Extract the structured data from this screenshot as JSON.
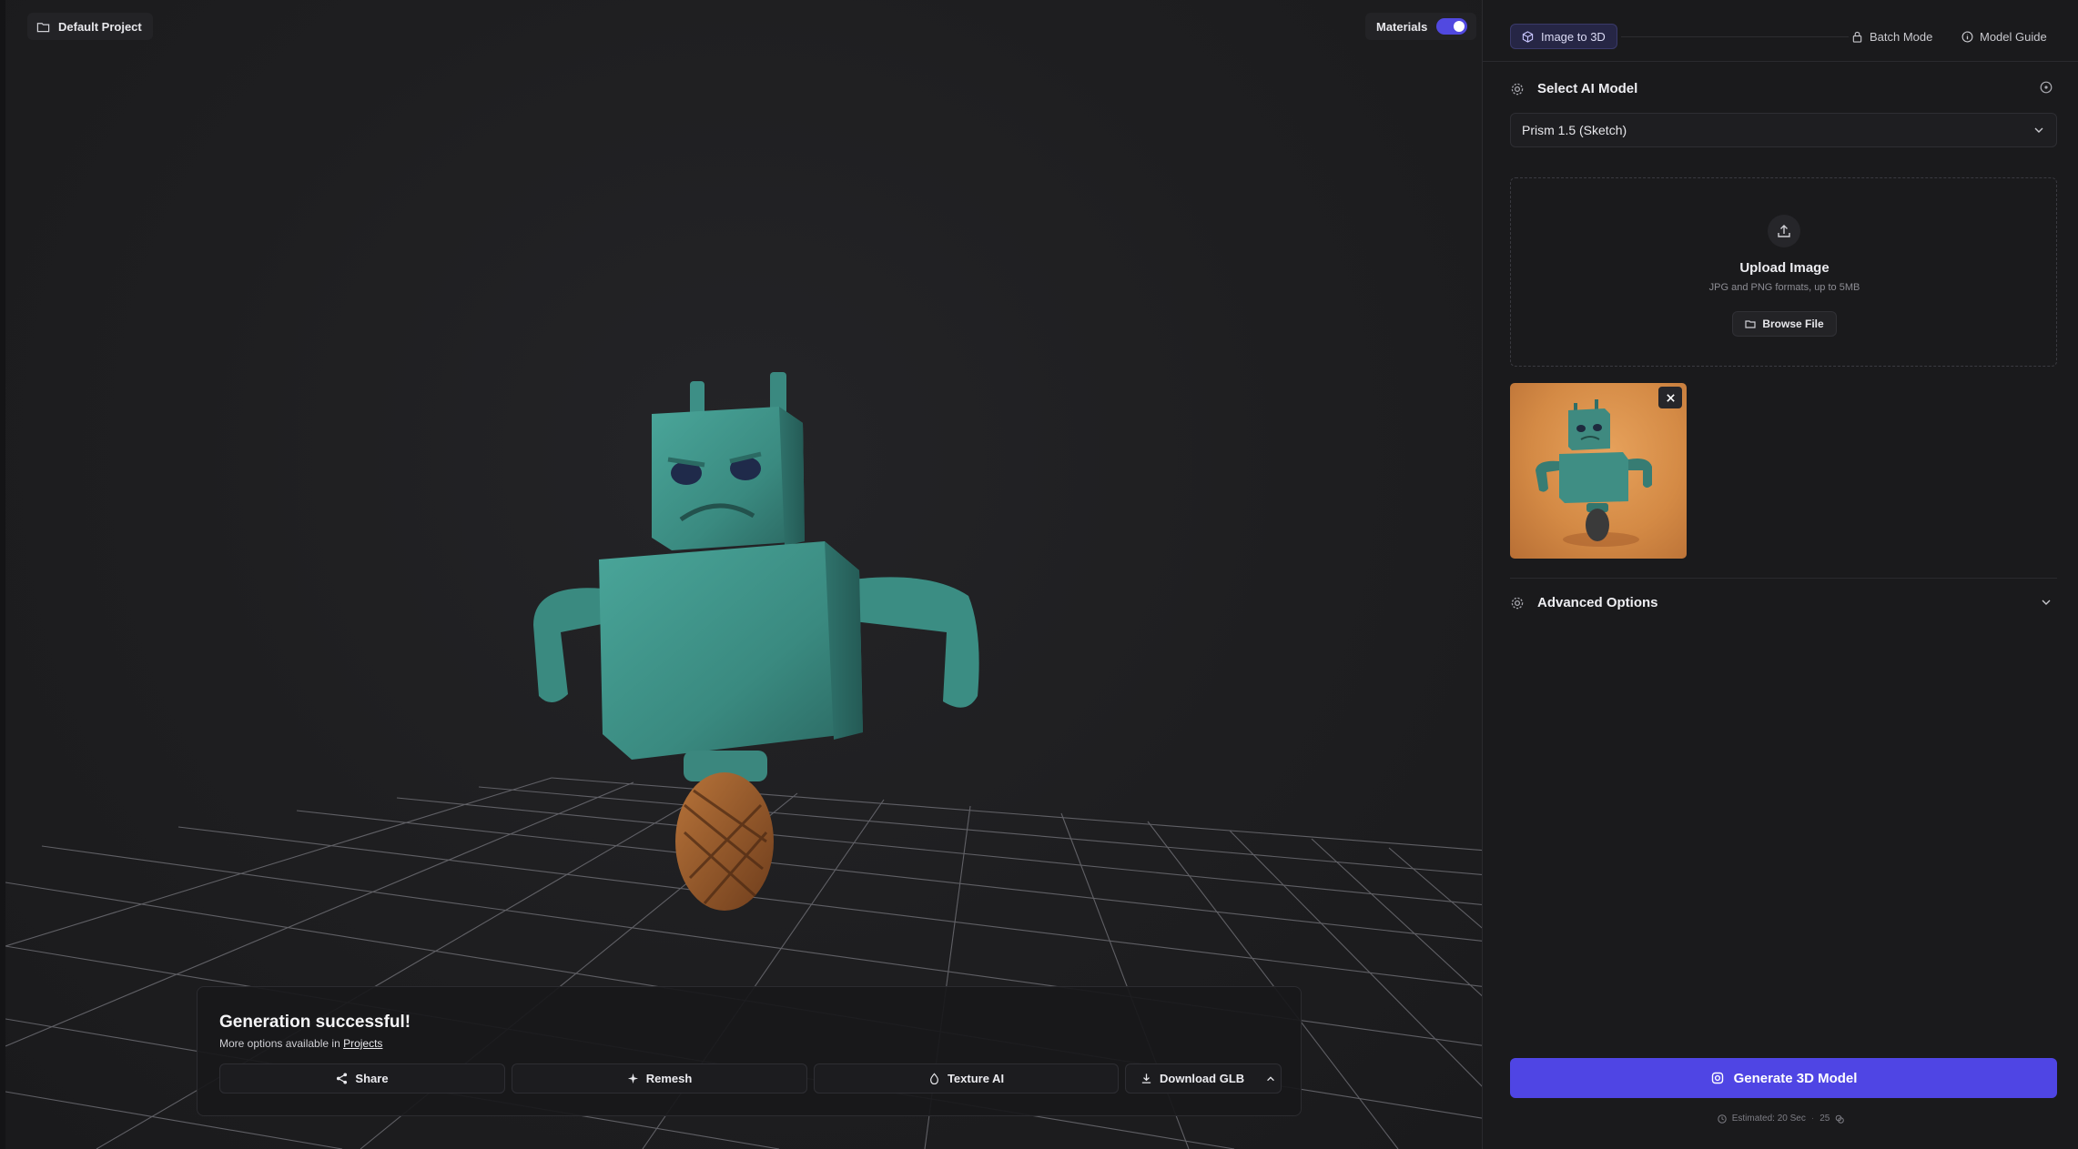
{
  "project": {
    "name": "Default Project"
  },
  "viewport": {
    "materials_label": "Materials",
    "materials_enabled": true
  },
  "result": {
    "title": "Generation successful!",
    "subtitle_prefix": "More options available in ",
    "projects_link": "Projects",
    "actions": {
      "share": "Share",
      "remesh": "Remesh",
      "texture": "Texture AI",
      "download": "Download GLB"
    }
  },
  "panel": {
    "tabs": {
      "image_to_3d": "Image to 3D",
      "batch_mode": "Batch Mode",
      "model_guide": "Model Guide"
    },
    "model_section": {
      "title": "Select AI Model",
      "selected": "Prism 1.5 (Sketch)"
    },
    "upload": {
      "title": "Upload Image",
      "subtitle": "JPG and PNG formats, up to 5MB",
      "browse": "Browse File"
    },
    "advanced": {
      "title": "Advanced Options"
    },
    "generate": {
      "label": "Generate 3D Model",
      "estimate": "Estimated: 20 Sec",
      "cost": "25"
    }
  },
  "colors": {
    "accent": "#4f45e4",
    "background": "#1b1b1d",
    "robot_body": "#3f948a",
    "wheel": "#9b5a2a",
    "thumb_bg": "#d48a45"
  }
}
